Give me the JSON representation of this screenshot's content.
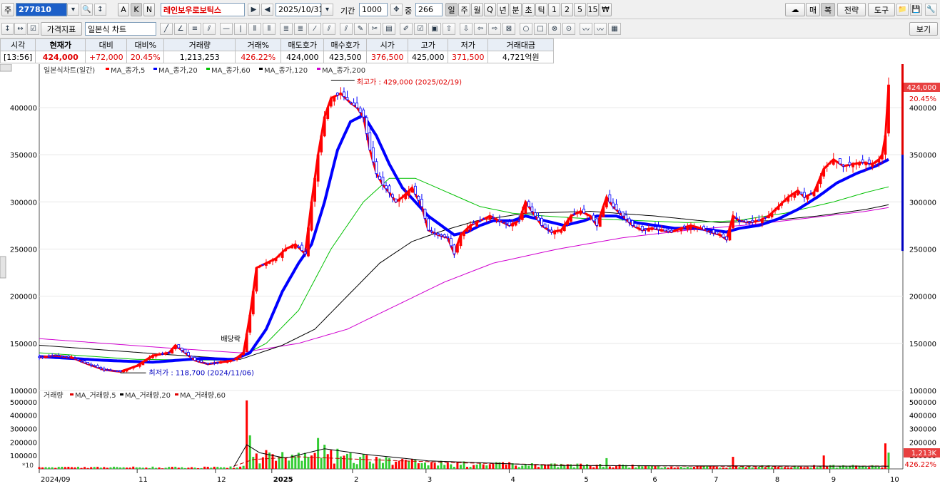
{
  "toolbar1": {
    "market_label": "주",
    "code": "277810",
    "name": "레인보우로보틱스",
    "k_labels": [
      "A",
      "K",
      "N"
    ],
    "date": "2025/10/31",
    "period_label": "기간",
    "period_value": "1000",
    "count_label": "중",
    "count_value": "266",
    "tabs": [
      "일",
      "주",
      "월",
      "Q",
      "년",
      "분",
      "초",
      "틱",
      "1",
      "2",
      "5",
      "15",
      "₩"
    ],
    "right_buttons": [
      "매",
      "복",
      "전략",
      "도구"
    ]
  },
  "toolbar2": {
    "price_indicator": "가격지표",
    "chart_type": "일본식 차트",
    "view_button": "보기"
  },
  "quote": {
    "headers": [
      "시각",
      "현재가",
      "대비",
      "대비%",
      "거래량",
      "거래%",
      "매도호가",
      "매수호가",
      "시가",
      "고가",
      "저가",
      "거래대금"
    ],
    "values": [
      "[13:56]",
      "424,000",
      "+72,000",
      "20.45%",
      "1,213,253",
      "426.22%",
      "424,000",
      "423,500",
      "376,500",
      "425,000",
      "371,500",
      "4,721억원"
    ]
  },
  "colors": {
    "up": "#ff0000",
    "down": "#0000ff",
    "ma5": "#ff0000",
    "ma20": "#0000ff",
    "ma60": "#00c000",
    "ma120": "#000000",
    "ma200": "#d000d0",
    "quote_header_bg": "#e8eef6",
    "volume_bar": "#33cc33"
  },
  "chart_data": [
    {
      "type": "candlestick",
      "title": "일본식차트(일간)",
      "legend": [
        "MA_종가,5",
        "MA_종가,20",
        "MA_종가,60",
        "MA_종가,120",
        "MA_종가,200"
      ],
      "ylim": [
        100000,
        440000
      ],
      "yticks": [
        100000,
        150000,
        200000,
        250000,
        300000,
        350000,
        400000
      ],
      "x_ticks": [
        "2024/09",
        "11",
        "12",
        "2025",
        "2",
        "3",
        "4",
        "5",
        "6",
        "7",
        "8",
        "9",
        "10"
      ],
      "annotations": {
        "high": "최고가 : 429,000 (2025/02/19)",
        "low": "최저가 : 118,700 (2024/11/06)",
        "dividend": "배당락"
      },
      "last_price_label": "424,000",
      "last_change_label": "20.45%",
      "price_path": [
        [
          0,
          135000
        ],
        [
          5,
          137000
        ],
        [
          10,
          135000
        ],
        [
          15,
          128000
        ],
        [
          20,
          122000
        ],
        [
          25,
          120000
        ],
        [
          30,
          126000
        ],
        [
          35,
          137000
        ],
        [
          40,
          140000
        ],
        [
          42,
          148000
        ],
        [
          45,
          140000
        ],
        [
          48,
          132000
        ],
        [
          52,
          128000
        ],
        [
          56,
          130000
        ],
        [
          60,
          132000
        ],
        [
          63,
          140000
        ],
        [
          65,
          180000
        ],
        [
          67,
          230000
        ],
        [
          70,
          235000
        ],
        [
          73,
          240000
        ],
        [
          76,
          250000
        ],
        [
          79,
          255000
        ],
        [
          82,
          245000
        ],
        [
          84,
          300000
        ],
        [
          86,
          350000
        ],
        [
          88,
          390000
        ],
        [
          90,
          410000
        ],
        [
          93,
          415000
        ],
        [
          96,
          405000
        ],
        [
          98,
          400000
        ],
        [
          100,
          390000
        ],
        [
          102,
          355000
        ],
        [
          104,
          330000
        ],
        [
          106,
          318000
        ],
        [
          108,
          310000
        ],
        [
          110,
          300000
        ],
        [
          112,
          305000
        ],
        [
          115,
          315000
        ],
        [
          118,
          295000
        ],
        [
          120,
          270000
        ],
        [
          123,
          265000
        ],
        [
          126,
          262000
        ],
        [
          128,
          245000
        ],
        [
          130,
          265000
        ],
        [
          133,
          275000
        ],
        [
          136,
          280000
        ],
        [
          139,
          285000
        ],
        [
          142,
          280000
        ],
        [
          145,
          275000
        ],
        [
          148,
          280000
        ],
        [
          150,
          300000
        ],
        [
          152,
          290000
        ],
        [
          155,
          275000
        ],
        [
          158,
          268000
        ],
        [
          161,
          270000
        ],
        [
          164,
          285000
        ],
        [
          167,
          290000
        ],
        [
          170,
          285000
        ],
        [
          172,
          275000
        ],
        [
          175,
          305000
        ],
        [
          177,
          295000
        ],
        [
          180,
          285000
        ],
        [
          183,
          275000
        ],
        [
          186,
          270000
        ],
        [
          189,
          272000
        ],
        [
          192,
          270000
        ],
        [
          195,
          268000
        ],
        [
          198,
          272000
        ],
        [
          201,
          275000
        ],
        [
          204,
          272000
        ],
        [
          207,
          268000
        ],
        [
          210,
          265000
        ],
        [
          212,
          260000
        ],
        [
          214,
          285000
        ],
        [
          216,
          280000
        ],
        [
          219,
          278000
        ],
        [
          222,
          280000
        ],
        [
          225,
          285000
        ],
        [
          228,
          295000
        ],
        [
          231,
          305000
        ],
        [
          234,
          312000
        ],
        [
          236,
          305000
        ],
        [
          239,
          310000
        ],
        [
          242,
          335000
        ],
        [
          245,
          345000
        ],
        [
          248,
          338000
        ],
        [
          251,
          340000
        ],
        [
          254,
          342000
        ],
        [
          257,
          340000
        ],
        [
          259,
          345000
        ],
        [
          260,
          350000
        ],
        [
          261,
          370000
        ],
        [
          262,
          424000
        ]
      ],
      "ma20_path": [
        [
          0,
          136000
        ],
        [
          20,
          132000
        ],
        [
          35,
          130000
        ],
        [
          50,
          134000
        ],
        [
          60,
          133000
        ],
        [
          65,
          140000
        ],
        [
          70,
          165000
        ],
        [
          75,
          205000
        ],
        [
          80,
          235000
        ],
        [
          84,
          255000
        ],
        [
          88,
          300000
        ],
        [
          92,
          355000
        ],
        [
          96,
          385000
        ],
        [
          100,
          392000
        ],
        [
          104,
          370000
        ],
        [
          108,
          340000
        ],
        [
          112,
          315000
        ],
        [
          116,
          300000
        ],
        [
          120,
          285000
        ],
        [
          124,
          275000
        ],
        [
          128,
          265000
        ],
        [
          132,
          268000
        ],
        [
          136,
          275000
        ],
        [
          140,
          280000
        ],
        [
          146,
          280000
        ],
        [
          150,
          285000
        ],
        [
          156,
          280000
        ],
        [
          162,
          275000
        ],
        [
          168,
          280000
        ],
        [
          172,
          285000
        ],
        [
          178,
          285000
        ],
        [
          184,
          278000
        ],
        [
          190,
          275000
        ],
        [
          196,
          272000
        ],
        [
          202,
          272000
        ],
        [
          208,
          270000
        ],
        [
          212,
          268000
        ],
        [
          216,
          272000
        ],
        [
          222,
          275000
        ],
        [
          228,
          282000
        ],
        [
          234,
          292000
        ],
        [
          240,
          305000
        ],
        [
          246,
          320000
        ],
        [
          252,
          330000
        ],
        [
          258,
          338000
        ],
        [
          262,
          345000
        ]
      ],
      "ma60_path": [
        [
          0,
          140000
        ],
        [
          30,
          133000
        ],
        [
          60,
          132000
        ],
        [
          70,
          150000
        ],
        [
          80,
          185000
        ],
        [
          90,
          250000
        ],
        [
          100,
          300000
        ],
        [
          108,
          325000
        ],
        [
          116,
          325000
        ],
        [
          126,
          310000
        ],
        [
          136,
          295000
        ],
        [
          146,
          288000
        ],
        [
          156,
          285000
        ],
        [
          170,
          282000
        ],
        [
          186,
          280000
        ],
        [
          200,
          278000
        ],
        [
          215,
          280000
        ],
        [
          230,
          288000
        ],
        [
          245,
          300000
        ],
        [
          255,
          310000
        ],
        [
          262,
          316000
        ]
      ],
      "ma120_path": [
        [
          0,
          148000
        ],
        [
          40,
          138000
        ],
        [
          62,
          133000
        ],
        [
          75,
          148000
        ],
        [
          85,
          165000
        ],
        [
          95,
          200000
        ],
        [
          105,
          235000
        ],
        [
          115,
          258000
        ],
        [
          125,
          270000
        ],
        [
          135,
          280000
        ],
        [
          150,
          288000
        ],
        [
          170,
          290000
        ],
        [
          190,
          285000
        ],
        [
          210,
          278000
        ],
        [
          225,
          280000
        ],
        [
          240,
          285000
        ],
        [
          255,
          292000
        ],
        [
          262,
          297000
        ]
      ],
      "ma200_path": [
        [
          0,
          155000
        ],
        [
          40,
          145000
        ],
        [
          62,
          140000
        ],
        [
          80,
          150000
        ],
        [
          95,
          165000
        ],
        [
          110,
          190000
        ],
        [
          125,
          215000
        ],
        [
          140,
          235000
        ],
        [
          160,
          250000
        ],
        [
          180,
          262000
        ],
        [
          200,
          270000
        ],
        [
          220,
          276000
        ],
        [
          240,
          284000
        ],
        [
          255,
          290000
        ],
        [
          262,
          294000
        ]
      ]
    },
    {
      "type": "bar",
      "title": "거래량",
      "legend": [
        "MA_거래량,5",
        "MA_거래량,20",
        "MA_거래량,60"
      ],
      "ylim": [
        0,
        520000
      ],
      "yticks": [
        100000,
        200000,
        300000,
        400000,
        500000
      ],
      "scale_note": "*10",
      "last_volume_label": "1,213K",
      "last_ratio_label": "426.22%",
      "spikes": [
        [
          64,
          510000
        ],
        [
          65,
          250000
        ],
        [
          66,
          90000
        ],
        [
          70,
          140000
        ],
        [
          72,
          110000
        ],
        [
          74,
          90000
        ],
        [
          76,
          80000
        ],
        [
          80,
          120000
        ],
        [
          84,
          100000
        ],
        [
          86,
          230000
        ],
        [
          88,
          180000
        ],
        [
          90,
          140000
        ],
        [
          92,
          150000
        ],
        [
          96,
          120000
        ],
        [
          100,
          110000
        ],
        [
          104,
          90000
        ],
        [
          108,
          80000
        ],
        [
          112,
          75000
        ],
        [
          116,
          70000
        ],
        [
          175,
          80000
        ],
        [
          214,
          90000
        ],
        [
          242,
          100000
        ],
        [
          261,
          190000
        ],
        [
          262,
          121300
        ]
      ]
    }
  ]
}
